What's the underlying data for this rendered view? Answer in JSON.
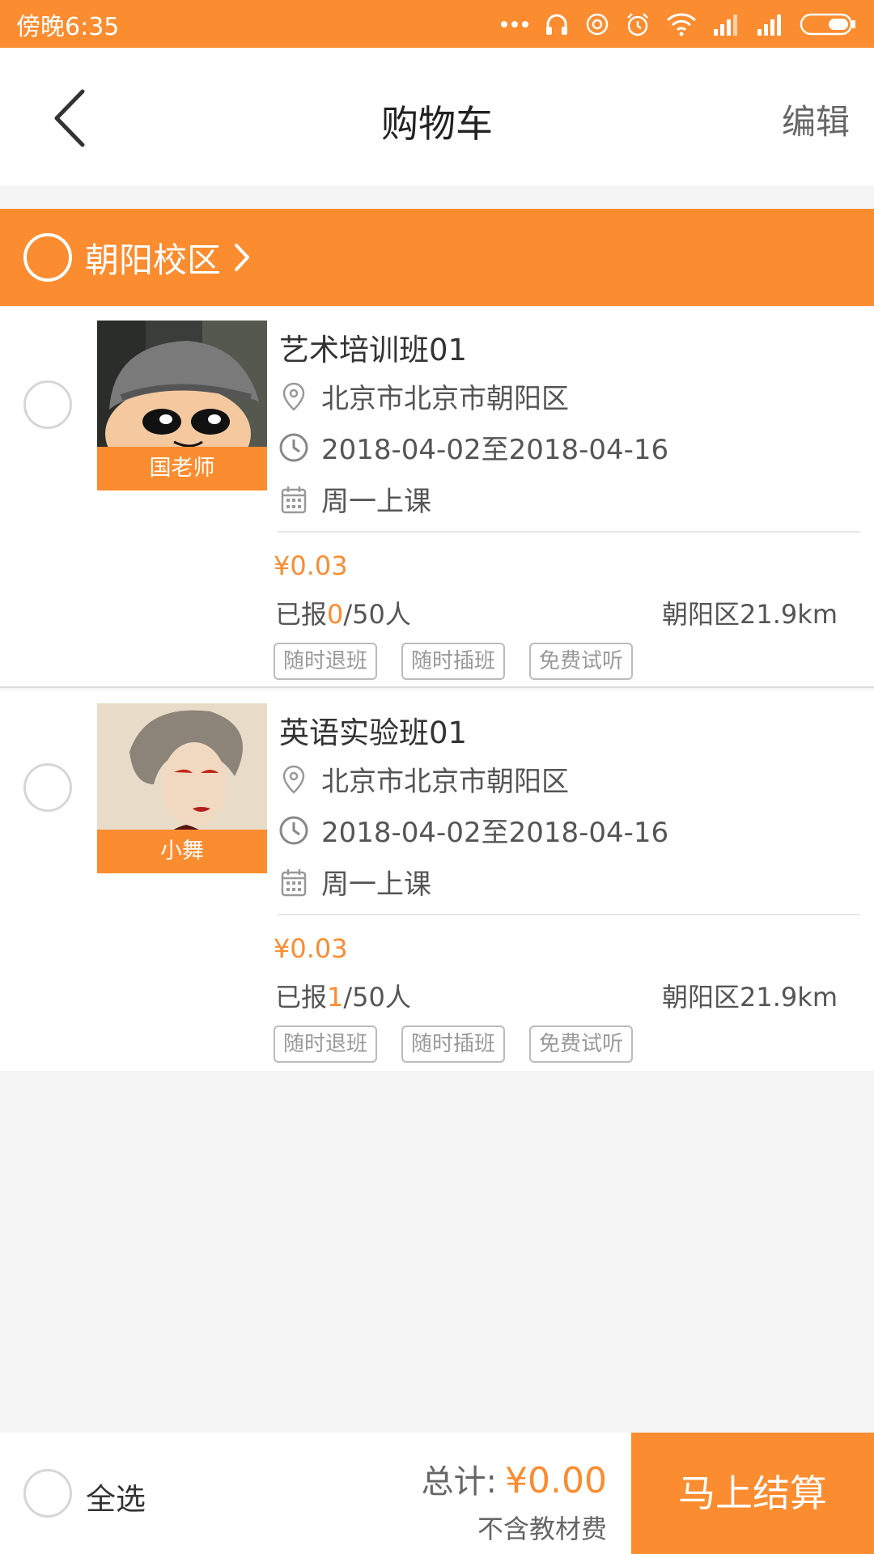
{
  "status_bar": {
    "time": "傍晚6:35"
  },
  "nav": {
    "title": "购物车",
    "edit_label": "编辑"
  },
  "campus": {
    "name": "朝阳校区"
  },
  "courses": [
    {
      "title": "艺术培训班01",
      "teacher": "国老师",
      "address": "北京市北京市朝阳区",
      "date_range": "2018-04-02至2018-04-16",
      "schedule": "周一上课",
      "price": "¥0.03",
      "enrolled_prefix": "已报",
      "enrolled_count": "0",
      "enrolled_suffix": "/50人",
      "distance": "朝阳区21.9km",
      "tags": [
        "随时退班",
        "随时插班",
        "免费试听"
      ]
    },
    {
      "title": "英语实验班01",
      "teacher": "小舞",
      "address": "北京市北京市朝阳区",
      "date_range": "2018-04-02至2018-04-16",
      "schedule": "周一上课",
      "price": "¥0.03",
      "enrolled_prefix": "已报",
      "enrolled_count": "1",
      "enrolled_suffix": "/50人",
      "distance": "朝阳区21.9km",
      "tags": [
        "随时退班",
        "随时插班",
        "免费试听"
      ]
    }
  ],
  "footer": {
    "select_all_label": "全选",
    "total_label": "总计:",
    "total_amount": "¥0.00",
    "total_note": "不含教材费",
    "checkout_label": "马上结算"
  },
  "colors": {
    "accent": "#fb8c2f",
    "background": "#f5f5f5"
  }
}
